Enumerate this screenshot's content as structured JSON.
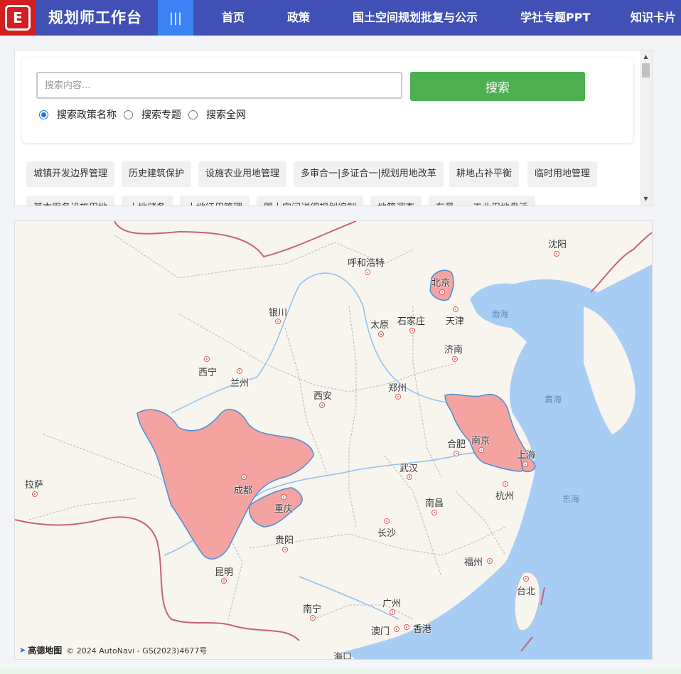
{
  "header": {
    "logo_glyph": "E",
    "brand": "规划师工作台",
    "menu_icon": "|||",
    "nav": [
      "首页",
      "政策",
      "国土空间规划批复与公示",
      "学社专题PPT",
      "知识卡片"
    ],
    "bg": "#4050b5",
    "logo_bg": "#d31f1f",
    "menu_bg": "#3b82f6"
  },
  "search": {
    "placeholder": "搜索内容...",
    "button": "搜索",
    "button_color": "#4caf50",
    "options": [
      "搜索政策名称",
      "搜索专题",
      "搜索全网"
    ],
    "selected": 0
  },
  "tags": [
    "城镇开发边界管理",
    "历史建筑保护",
    "设施农业用地管理",
    "多审合一|多证合一|规划用地改革",
    "耕地占补平衡",
    "临时用地管理",
    "基本服务设施用地",
    "土地储备",
    "土地征用管理",
    "国土空间详细规划编制",
    "地籍调查",
    "存量——工业用地盘活"
  ],
  "map": {
    "cities": [
      "呼和浩特",
      "北京",
      "天津",
      "沈阳",
      "银川",
      "太原",
      "石家庄",
      "济南",
      "西宁",
      "兰州",
      "西安",
      "郑州",
      "合肥",
      "南京",
      "上海",
      "武汉",
      "杭州",
      "成都",
      "重庆",
      "拉萨",
      "南昌",
      "长沙",
      "贵阳",
      "昆明",
      "福州",
      "台北",
      "南宁",
      "广州",
      "澳门",
      "香港",
      "海口"
    ],
    "seas": [
      "渤海",
      "黄海",
      "东海"
    ],
    "highlight_color": "#f4a3a0",
    "highlight_regions": [
      "北京",
      "四川",
      "重庆",
      "江苏",
      "上海"
    ],
    "attribution_logo": "高德地图",
    "attribution_text": "© 2024 AutoNavi - GS(2023)4677号"
  }
}
